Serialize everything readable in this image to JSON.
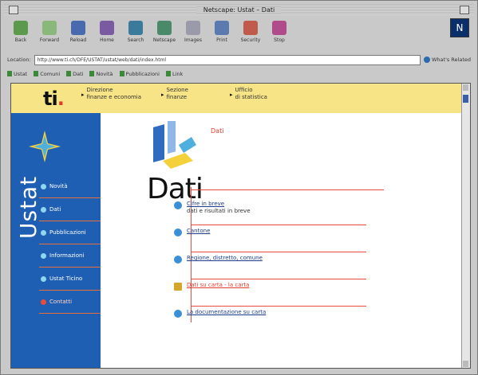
{
  "window": {
    "title": "Netscape: Ustat – Dati"
  },
  "toolbar": {
    "buttons": [
      {
        "label": "Back",
        "icon": "back-arrow-icon",
        "color": "#5a9a4a"
      },
      {
        "label": "Forward",
        "icon": "forward-arrow-icon",
        "color": "#8ab87a"
      },
      {
        "label": "Reload",
        "icon": "reload-icon",
        "color": "#4a6ab0"
      },
      {
        "label": "Home",
        "icon": "home-icon",
        "color": "#7a5aa0"
      },
      {
        "label": "Search",
        "icon": "search-icon",
        "color": "#3a7a9a"
      },
      {
        "label": "Netscape",
        "icon": "netscape-icon",
        "color": "#4a8a6a"
      },
      {
        "label": "Images",
        "icon": "images-icon",
        "color": "#9a9aaa"
      },
      {
        "label": "Print",
        "icon": "print-icon",
        "color": "#5a7ab0"
      },
      {
        "label": "Security",
        "icon": "lock-icon",
        "color": "#c05a4a"
      },
      {
        "label": "Stop",
        "icon": "stop-icon",
        "color": "#b04a8a"
      }
    ]
  },
  "location": {
    "label": "Location:",
    "url": "http://www.ti.ch/DFE/USTAT/ustat/web/dati/index.html",
    "related": "What's Related"
  },
  "bookmarks": [
    "Ustat",
    "Comuni",
    "Dati",
    "Novità",
    "Pubblicazioni",
    "Link"
  ],
  "header": {
    "logo": "ti",
    "nav": [
      {
        "line1": "Direzione",
        "line2": "finanze e economia"
      },
      {
        "line1": "Sezione",
        "line2": "finanze"
      },
      {
        "line1": "Ufficio",
        "line2": "di statistica"
      }
    ]
  },
  "sidebar": {
    "brand": "Ustat",
    "items": [
      {
        "label": "Novità",
        "active": false
      },
      {
        "label": "Dati",
        "active": false
      },
      {
        "label": "Pubblicazioni",
        "active": false
      },
      {
        "label": "Informazioni",
        "active": false
      },
      {
        "label": "Ustat Ticino",
        "active": false
      },
      {
        "label": "Contatti",
        "active": true
      }
    ]
  },
  "main": {
    "label": "Dati",
    "title": "Dati",
    "items": [
      {
        "link": "Cifre in breve",
        "sub": "dati e risultati in breve"
      },
      {
        "link": "Cantone",
        "sub": ""
      },
      {
        "link": "Regione, distretto, comune",
        "sub": ""
      },
      {
        "link": "Dati su carta - la carta",
        "sub": ""
      },
      {
        "link": "La documentazione su carta",
        "sub": ""
      }
    ]
  },
  "colors": {
    "header_bg": "#f7e486",
    "sidebar_bg": "#1f5fb3",
    "accent_red": "#e23c2c"
  }
}
